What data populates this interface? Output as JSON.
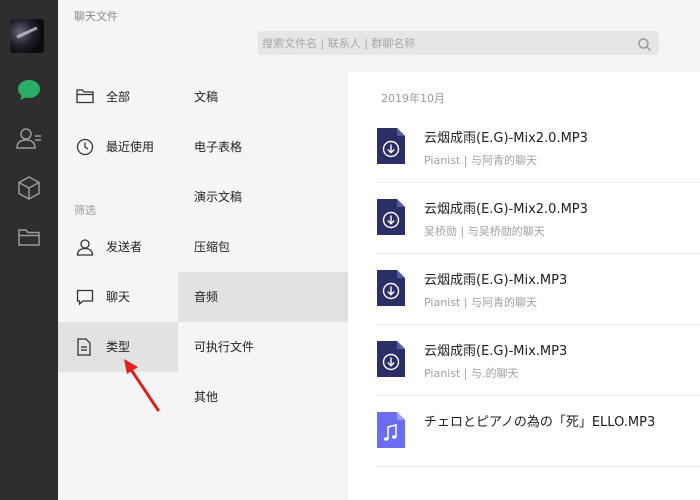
{
  "app": {
    "title": "聊天文件"
  },
  "search": {
    "placeholder": "搜索文件名 | 联系人 | 群聊名称"
  },
  "rail": {
    "icons": [
      "chat-icon",
      "contacts-icon",
      "cube-icon",
      "folder-icon"
    ],
    "accent": "#2aae67",
    "icon_color": "#9a9a9a"
  },
  "categories": {
    "all": "全部",
    "recent": "最近使用",
    "filter_section": "筛选",
    "sender": "发送者",
    "chat": "聊天",
    "type": "类型"
  },
  "file_types": [
    "文稿",
    "电子表格",
    "演示文稿",
    "压缩包",
    "音频",
    "可执行文件",
    "其他"
  ],
  "selected_type": "音频",
  "file_list": {
    "month": "2019年10月",
    "files": [
      {
        "name": "云烟成雨(E.G)-Mix2.0.MP3",
        "meta": "Pianist | 与阿青的聊天",
        "icon": "download-icon"
      },
      {
        "name": "云烟成雨(E.G)-Mix2.0.MP3",
        "meta": "吴桥勋 | 与吴桥勋的聊天",
        "icon": "download-icon"
      },
      {
        "name": "云烟成雨(E.G)-Mix.MP3",
        "meta": "Pianist | 与阿青的聊天",
        "icon": "download-icon"
      },
      {
        "name": "云烟成雨(E.G)-Mix.MP3",
        "meta": "Pianist | 与.的聊天",
        "icon": "download-icon"
      },
      {
        "name": "チェロとピアノの為の「死」ELLO.MP3",
        "meta": "",
        "icon": "music-note-icon"
      }
    ]
  },
  "colors": {
    "file_icon_dark": "#2c2f66",
    "file_icon_music": "#6b6cf0",
    "annotation_arrow": "#e02020"
  }
}
